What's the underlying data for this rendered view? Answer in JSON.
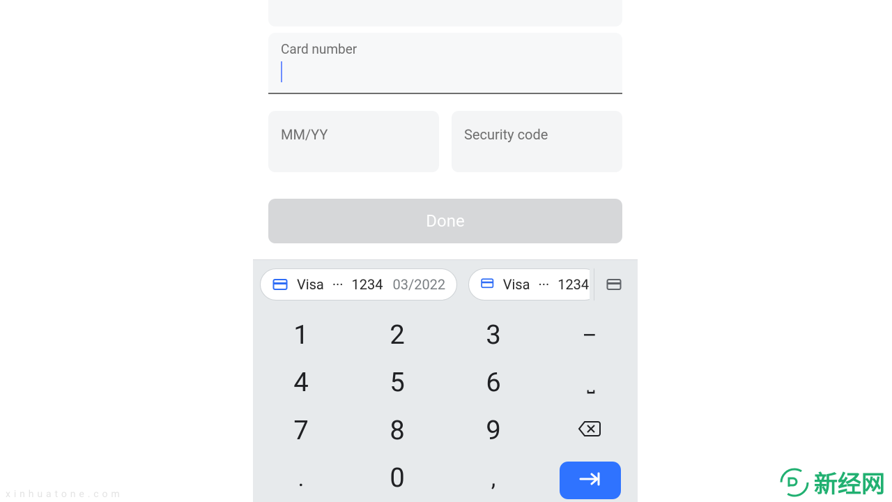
{
  "form": {
    "card_number_label": "Card number",
    "mmYY_placeholder": "MM/YY",
    "security_code_placeholder": "Security code",
    "done_label": "Done"
  },
  "autofill": {
    "chips": [
      {
        "brand": "Visa",
        "dots": "···",
        "last4": "1234",
        "expiry": "03/2022"
      },
      {
        "brand": "Visa",
        "dots": "···",
        "last4": "1234",
        "expiry": ""
      }
    ]
  },
  "keypad": {
    "rows": [
      [
        "1",
        "2",
        "3",
        "–"
      ],
      [
        "4",
        "5",
        "6",
        "␣"
      ],
      [
        "7",
        "8",
        "9",
        "⌫"
      ],
      [
        ".",
        "0",
        ",",
        "go"
      ]
    ]
  },
  "watermark": {
    "left": "xinhuatone.com",
    "right_text": "新经网"
  }
}
